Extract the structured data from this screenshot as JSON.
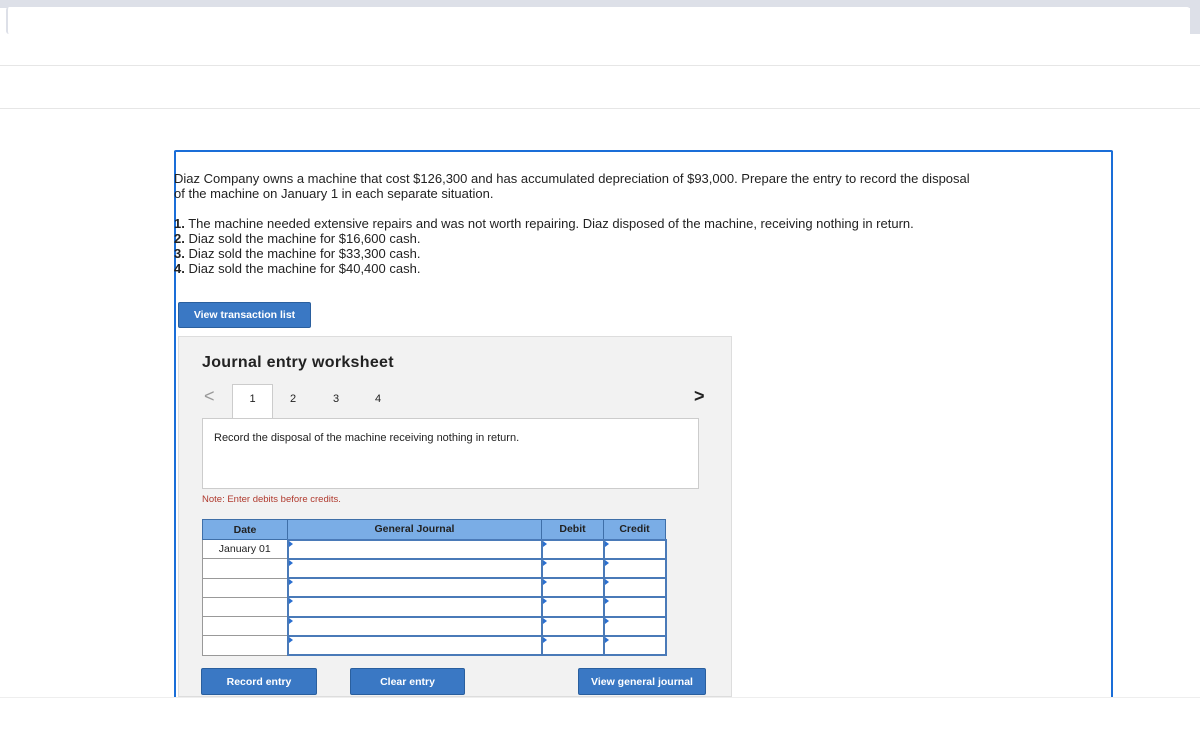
{
  "question": {
    "text": "Diaz Company owns a machine that cost $126,300 and has accumulated depreciation of $93,000. Prepare the entry to record the disposal of the machine on January 1 in each separate situation.",
    "items": [
      {
        "num": "1.",
        "text": " The machine needed extensive repairs and was not worth repairing. Diaz disposed of the machine, receiving nothing in return."
      },
      {
        "num": "2.",
        "text": " Diaz sold the machine for $16,600 cash."
      },
      {
        "num": "3.",
        "text": " Diaz sold the machine for $33,300 cash."
      },
      {
        "num": "4.",
        "text": " Diaz sold the machine for $40,400 cash."
      }
    ]
  },
  "view_transaction_list": "View transaction list",
  "worksheet": {
    "title": "Journal entry worksheet",
    "tabs": [
      "1",
      "2",
      "3",
      "4"
    ],
    "active_tab": "1",
    "prev_icon": "<",
    "next_icon": ">",
    "description": "Record the disposal of the machine receiving nothing in return.",
    "note": "Note: Enter debits before credits.",
    "columns": [
      "Date",
      "General Journal",
      "Debit",
      "Credit"
    ],
    "rows": [
      {
        "date": "January 01"
      },
      {
        "date": ""
      },
      {
        "date": ""
      },
      {
        "date": ""
      },
      {
        "date": ""
      },
      {
        "date": ""
      }
    ],
    "buttons": {
      "record": "Record entry",
      "clear": "Clear entry",
      "view_journal": "View general journal"
    }
  },
  "colors": {
    "accent": "#3a78c4",
    "header": "#7aade6",
    "note": "#b03a2e",
    "frame": "#1a6ed8"
  }
}
